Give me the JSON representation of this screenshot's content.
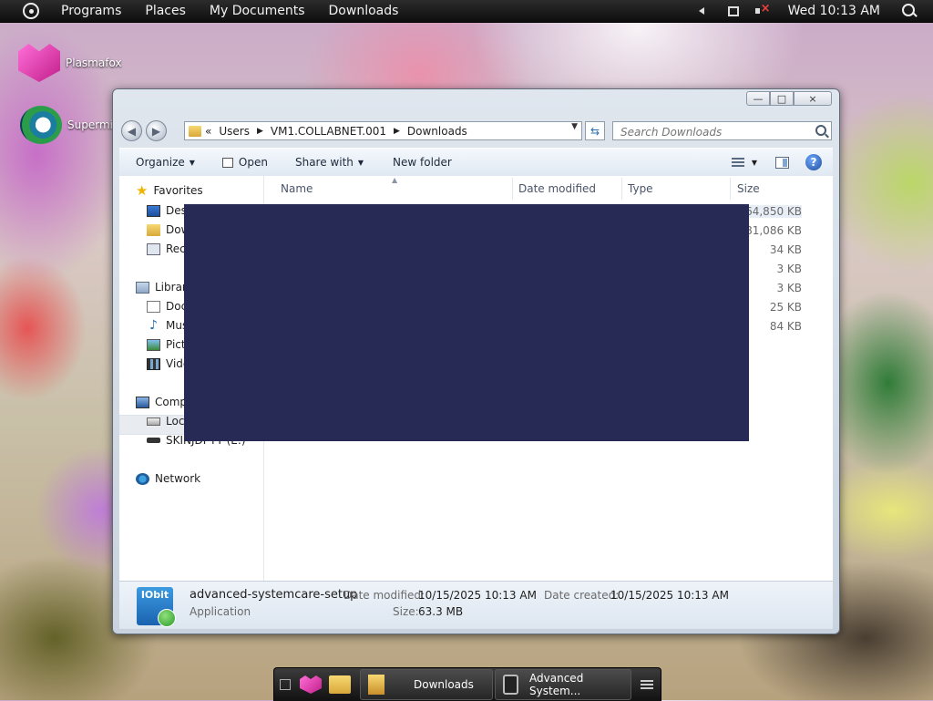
{
  "topbar": {
    "menu": [
      "Programs",
      "Places",
      "My Documents",
      "Downloads"
    ],
    "clock": "Wed 10:13 AM"
  },
  "desktop": {
    "icons": [
      {
        "label": "Plasmafox",
        "icon": "plasmafox-icon"
      },
      {
        "label": "Supermiu",
        "icon": "supermium-icon"
      }
    ]
  },
  "window": {
    "controls": {
      "minimize": "—",
      "maximize": "□",
      "close": "×"
    },
    "address": {
      "overflow": "«",
      "crumbs": [
        "Users",
        "VM1.COLLABNET.001",
        "Downloads"
      ],
      "separator": "▶"
    },
    "search": {
      "placeholder": "Search Downloads"
    },
    "toolbar": {
      "organize": "Organize",
      "open": "Open",
      "share_with": "Share with",
      "new_folder": "New folder"
    },
    "nav": {
      "favorites": "Favorites",
      "desktop": "Desk",
      "downloads": "Dow",
      "recent": "Rec",
      "libraries": "Librar",
      "documents": "Doc",
      "music": "Mus",
      "pictures": "Pict",
      "videos": "Vide",
      "computer": "Comp",
      "local_disk": "Loca",
      "usb_drive": "SKINJDI YY (E:)",
      "network": "Network"
    },
    "columns": {
      "name": "Name",
      "date_modified": "Date modified",
      "type": "Type",
      "size": "Size"
    },
    "sizes": [
      "64,850 KB",
      "81,086 KB",
      "34 KB",
      "3 KB",
      "3 KB",
      "25 KB",
      "84 KB"
    ],
    "details": {
      "icon_text": "IObit",
      "name": "advanced-systemcare-setup",
      "type": "Application",
      "date_modified_label": "Date modified:",
      "date_modified": "10/15/2025 10:13 AM",
      "size_label": "Size:",
      "size": "63.3 MB",
      "date_created_label": "Date created:",
      "date_created": "10/15/2025 10:13 AM"
    }
  },
  "taskbar": {
    "tasks": [
      {
        "label": "Downloads",
        "icon": "folder-icon"
      },
      {
        "label": "Advanced System...",
        "icon": "advanced-systemcare-icon"
      }
    ]
  }
}
